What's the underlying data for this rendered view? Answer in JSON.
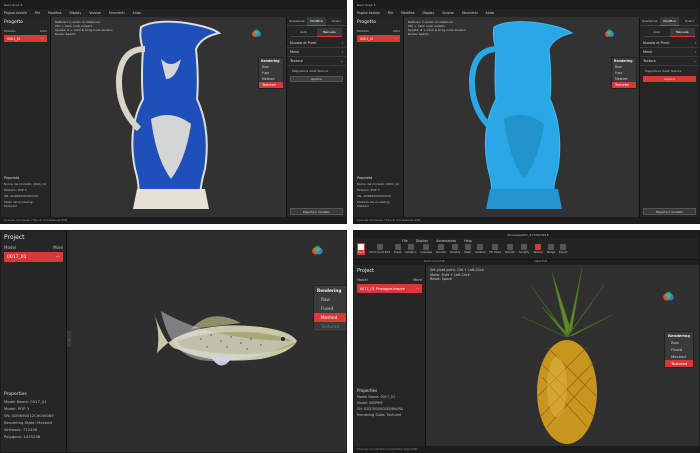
{
  "colors": {
    "accent": "#d93838",
    "bg": "#2b2b2b",
    "vase_blue": "#1f4fb8",
    "scan_blue": "#2aa8e6"
  },
  "q1": {
    "title": "Revo Scan 5",
    "menu": [
      "Pagina iniziale",
      "File",
      "Modifica",
      "Display",
      "Visione",
      "Strumenti",
      "Aiuto"
    ],
    "panel_title": "Progetto",
    "model_label": "Modello",
    "more": "Altro",
    "model_item": "0001_01",
    "hints": [
      "Definisci il centro di rotazione:",
      "Ctrl + Click nodo sinistro",
      "Sposta: Z + Click & Drag nodo sinistro",
      "Ruota: Spazio"
    ],
    "render_menu": {
      "title": "Rendering",
      "items": [
        "Raw",
        "Fuso",
        "Meshed",
        "Textured"
      ],
      "selected": "Textured"
    },
    "right_tabs": [
      "Scansione",
      "Modifica",
      "Unisci"
    ],
    "sub_tabs": [
      "Auto",
      "Manuale"
    ],
    "sections": [
      "Nuvola di Punti",
      "Mesh",
      "Texture"
    ],
    "texture_item": "Mappatura della Texture",
    "apply_btn": "Applica",
    "props_title": "Proprietà",
    "props": [
      "Nome del modello:  0001_01",
      "Modello:  POP 3",
      "SN:  AD9890002ZXXXX",
      "Stato del modeling:  Textured"
    ],
    "export_btn": "Esporta il modello",
    "status": "Scanner Connesso / Tipo di connessione USB"
  },
  "q2": {
    "title": "Revo Scan 5",
    "menu": [
      "Pagina iniziale",
      "File",
      "Modifica",
      "Display",
      "Visione",
      "Strumenti",
      "Aiuto"
    ],
    "panel_title": "Progetto",
    "model_label": "Modello",
    "more": "Altro",
    "model_item": "0001_01",
    "hints": [
      "Definisci il centro di rotazione:",
      "Ctrl + Click nodo sinistro",
      "Sposta: Z + Click & Drag nodo sinistro",
      "Ruota: Spazio"
    ],
    "render_menu": {
      "title": "Rendering",
      "items": [
        "Raw",
        "Fuso",
        "Meshed",
        "Textured"
      ],
      "selected": "Textured"
    },
    "right_tabs": [
      "Scansione",
      "Modifica",
      "Unisci"
    ],
    "sub_tabs": [
      "Auto",
      "Manuale"
    ],
    "sections": [
      "Nuvola di Punti",
      "Mesh",
      "Texture"
    ],
    "texture_item": "Mappatura della Texture",
    "apply_btn": "Applica",
    "props_title": "Proprietà",
    "props": [
      "Nome del modello:  0001_01",
      "Modello:  POP 3",
      "SN:  AD9890002ZXXXX",
      "Modello del modeling:  Meshed"
    ],
    "export_btn": "Esporta il modello",
    "status": "Scanner Connesso / Tipo di connessione USB"
  },
  "q3": {
    "panel_title": "Project",
    "model_label": "Model",
    "more": "More",
    "model_item": "0017_01",
    "render_menu": {
      "title": "Rendering",
      "items": [
        "Raw",
        "Fused",
        "Meshed",
        "Textured"
      ],
      "selected": "Meshed"
    },
    "props_title": "Properties",
    "props": [
      "Model Name:  0017_01",
      "Model:  POP 3",
      "SN:  AD9890012C0040085",
      "Rendering State:  Meshed",
      "Vertexes:  712498",
      "Polygons:  1425296"
    ]
  },
  "q4": {
    "title": "Pineapple001_0172024018",
    "menu": [
      "File",
      "Display",
      "Accessories",
      "Help"
    ],
    "tools": [
      "Back",
      "Point Cloud Edit",
      "Fused",
      "Isolation",
      "Overlaps",
      "Smooth",
      "Simplify",
      "Mesh",
      "Isolated",
      "Fill Holes",
      "Smooth",
      "Simplify",
      "Texture",
      "Merge",
      "Export"
    ],
    "group_labels": [
      "Point Cloud Edit",
      "Mesh Edit"
    ],
    "panel_title": "Project",
    "model_label": "Model",
    "more": "More",
    "model_item": "0017_01 Pineapple-Inspire",
    "hints": [
      "Set pivot point: Ctrl + Left-Click",
      "Move: Shift + Left-Click",
      "Reset: Space"
    ],
    "render_menu": {
      "title": "Rendering",
      "items": [
        "Raw",
        "Fused",
        "Meshed",
        "Textured"
      ],
      "selected": "Textured"
    },
    "props_title": "Properties",
    "props": [
      "Model Name:  0017_01",
      "Model:  INSPIRE",
      "SN:  A2D700D0D2D0RA0RA",
      "Rendering State:  Textured"
    ],
    "status": "Scanner Connected / Connection Type USB"
  }
}
